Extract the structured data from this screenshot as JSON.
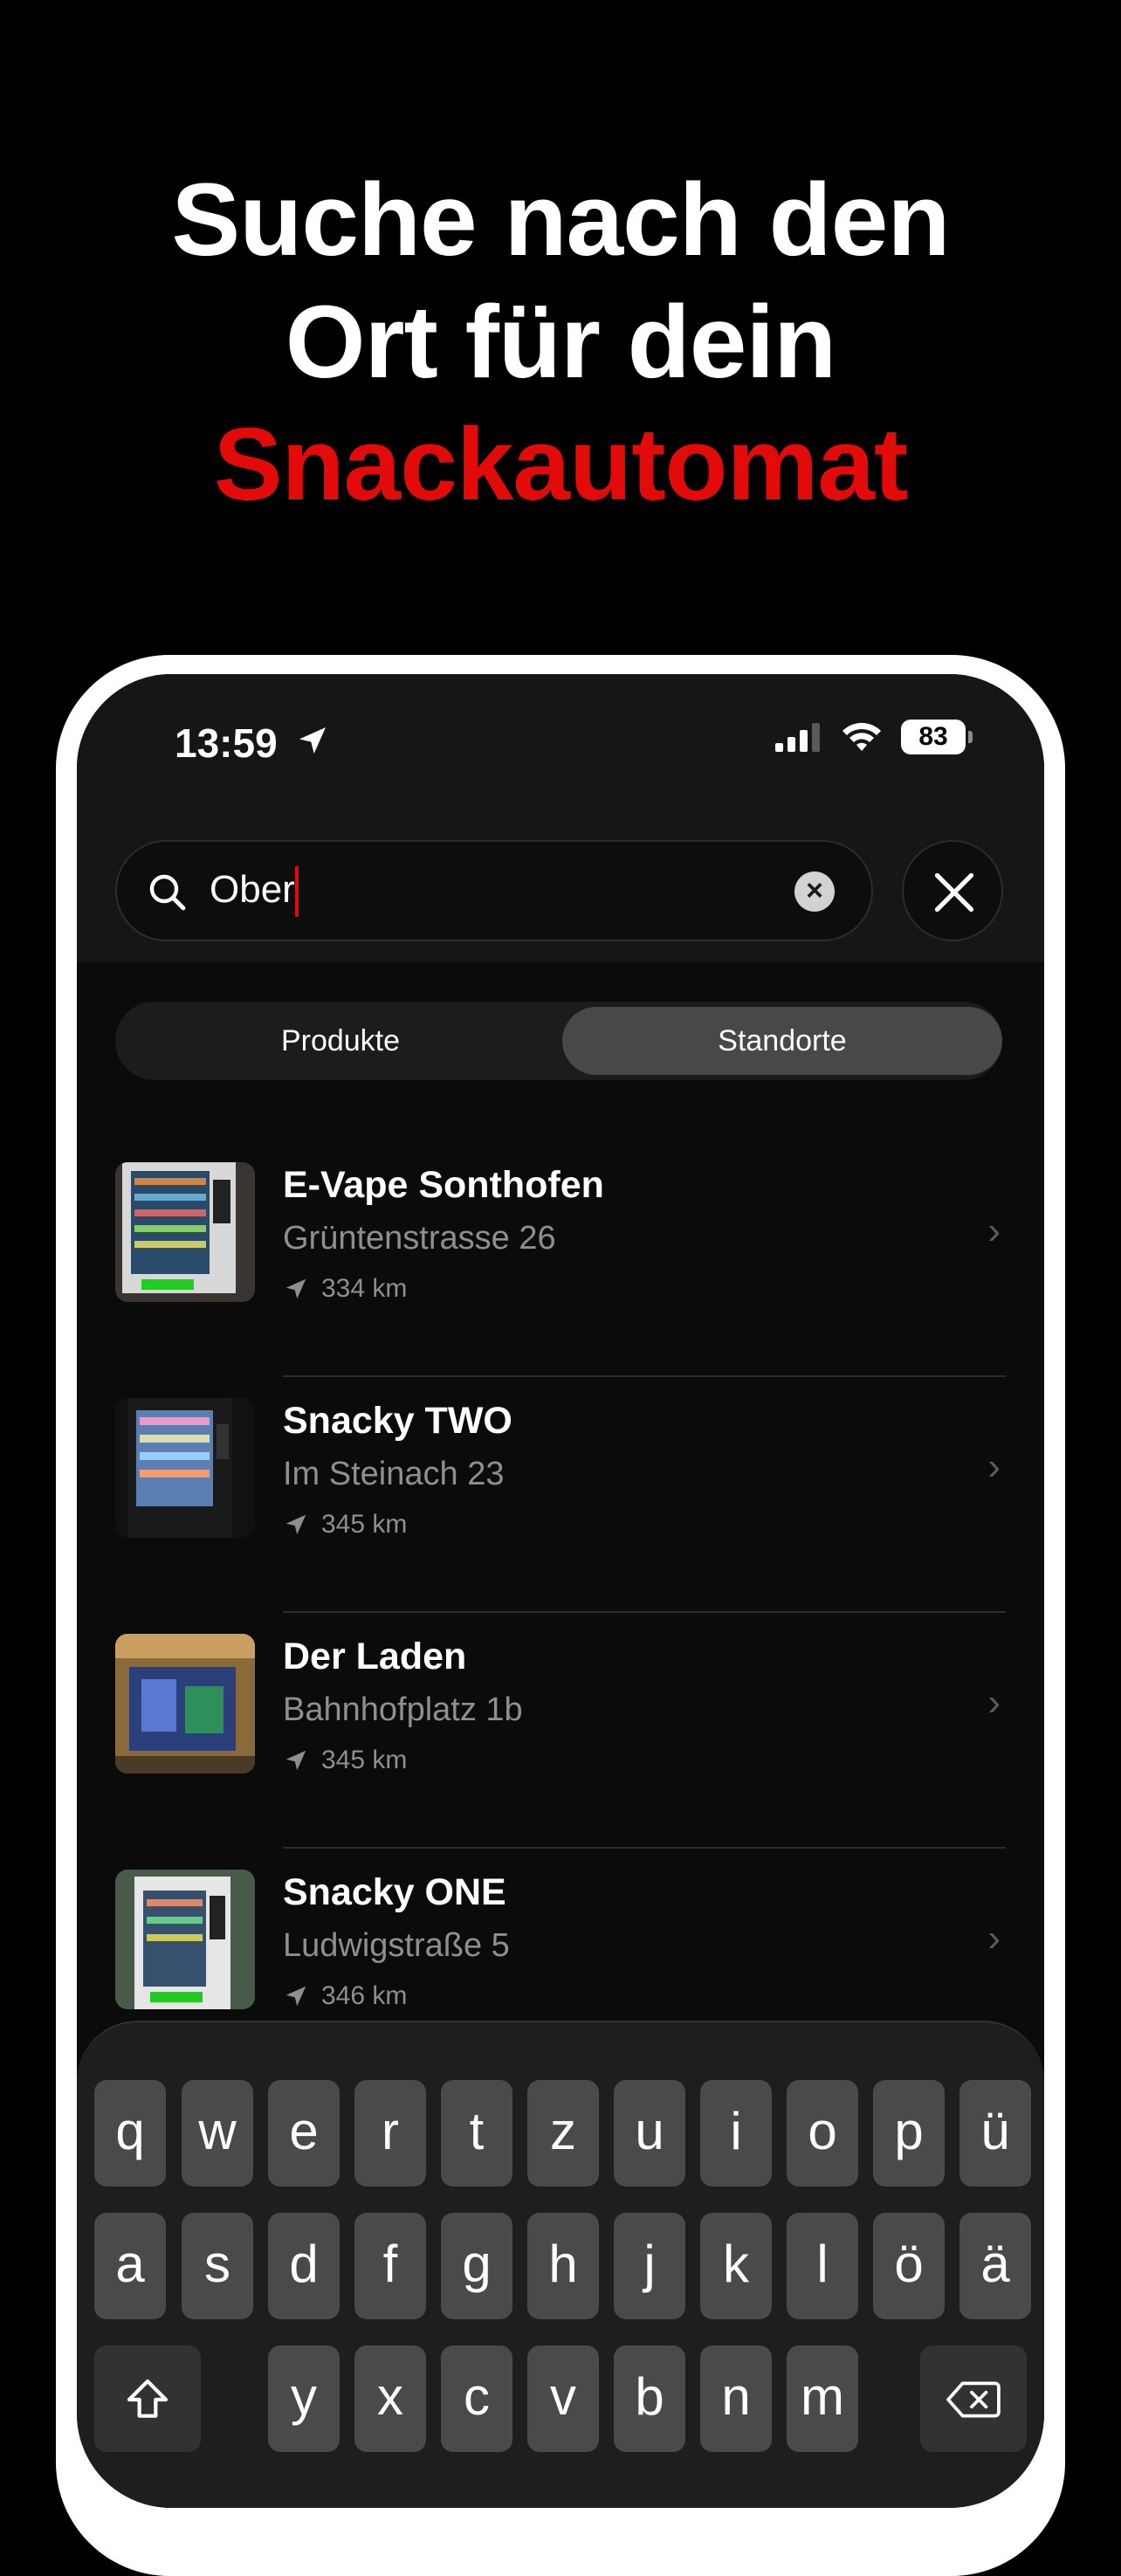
{
  "headline": {
    "line1": "Suche nach den",
    "line2": "Ort für dein",
    "line3": "Snackautomat"
  },
  "status_bar": {
    "time": "13:59",
    "battery": "83"
  },
  "search": {
    "value": "Ober"
  },
  "segments": {
    "left": "Produkte",
    "right": "Standorte",
    "selected": "Standorte"
  },
  "results": [
    {
      "title": "E-Vape Sonthofen",
      "address": "Grüntenstrasse 26",
      "distance": "334 km"
    },
    {
      "title": "Snacky TWO",
      "address": "Im Steinach 23",
      "distance": "345 km"
    },
    {
      "title": "Der Laden",
      "address": "Bahnhofplatz 1b",
      "distance": "345 km"
    },
    {
      "title": "Snacky ONE",
      "address": "Ludwigstraße 5",
      "distance": "346 km"
    }
  ],
  "keyboard": {
    "row1": [
      "q",
      "w",
      "e",
      "r",
      "t",
      "z",
      "u",
      "i",
      "o",
      "p",
      "ü"
    ],
    "row2": [
      "a",
      "s",
      "d",
      "f",
      "g",
      "h",
      "j",
      "k",
      "l",
      "ö",
      "ä"
    ],
    "row3": [
      "y",
      "x",
      "c",
      "v",
      "b",
      "n",
      "m"
    ]
  },
  "colors": {
    "accent": "#e30a0a",
    "background": "#000000"
  }
}
